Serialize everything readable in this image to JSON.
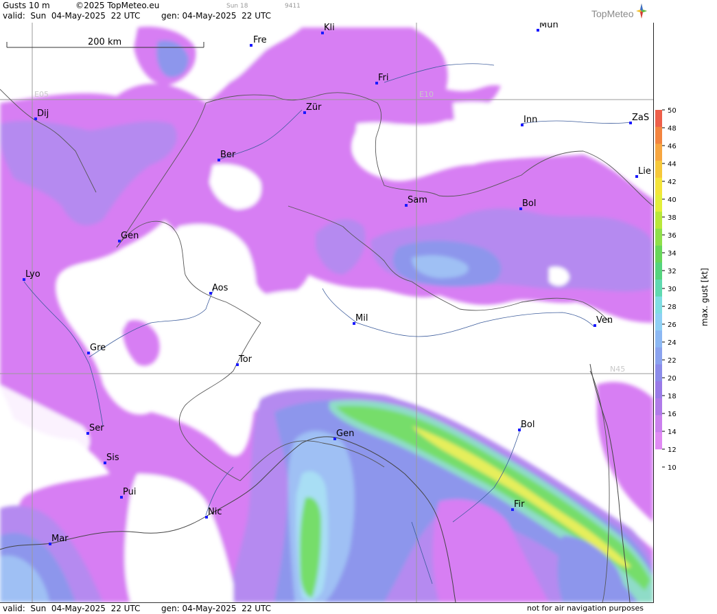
{
  "header": {
    "product": "Gusts 10 m",
    "copyright": "©2025 TopMeteo.eu",
    "small1": "Sun 18",
    "small2": "9411",
    "valid": "valid:  Sun  04-May-2025  22 UTC",
    "gen": "gen: 04-May-2025  22 UTC",
    "logo": "TopMeteo"
  },
  "footer": {
    "valid": "valid:  Sun  04-May-2025  22 UTC",
    "gen": "gen: 04-May-2025  22 UTC",
    "note": "not for air navigation purposes"
  },
  "scale": {
    "label": "200 km"
  },
  "grid_labels": {
    "e05": "E05",
    "e10": "E10",
    "n45": "N45"
  },
  "cities": [
    {
      "name": "Kli"
    },
    {
      "name": "Mün"
    },
    {
      "name": "Fre"
    },
    {
      "name": "Fri"
    },
    {
      "name": "Dij"
    },
    {
      "name": "Zür"
    },
    {
      "name": "Inn"
    },
    {
      "name": "ZaS"
    },
    {
      "name": "Ber"
    },
    {
      "name": "Lie"
    },
    {
      "name": "Sam"
    },
    {
      "name": "Bol"
    },
    {
      "name": "Gen"
    },
    {
      "name": "Lyo"
    },
    {
      "name": "Aos"
    },
    {
      "name": "Mil"
    },
    {
      "name": "Ven"
    },
    {
      "name": "Gre"
    },
    {
      "name": "Tor"
    },
    {
      "name": "Ser"
    },
    {
      "name": "Gen"
    },
    {
      "name": "Bol"
    },
    {
      "name": "Sis"
    },
    {
      "name": "Pui"
    },
    {
      "name": "Nic"
    },
    {
      "name": "Fir"
    },
    {
      "name": "Mar"
    }
  ],
  "legend": {
    "title": "max. gust [kt]",
    "ticks": [
      "50",
      "48",
      "46",
      "44",
      "42",
      "40",
      "38",
      "36",
      "34",
      "32",
      "30",
      "28",
      "26",
      "24",
      "22",
      "20",
      "18",
      "16",
      "14",
      "12",
      "10"
    ],
    "colors": [
      "#ee5f4a",
      "#f3843f",
      "#f7a640",
      "#f6c83a",
      "#f4e43a",
      "#e3ef3a",
      "#b9e83a",
      "#8fdf4a",
      "#67d65a",
      "#55d47e",
      "#5fd9b0",
      "#7fdde3",
      "#8fd0f5",
      "#8cb8f3",
      "#8ba3ef",
      "#8c8cea",
      "#9a7ae8",
      "#b07ae9",
      "#cb80ee",
      "#e08af3"
    ],
    "palette": {
      "violet": "#d77ef3",
      "lilac": "#b58af0",
      "blue": "#8d96ec",
      "lightblue": "#9fc0f4",
      "cyan": "#a8def4",
      "teal": "#8fdcc8",
      "green": "#76dd6a",
      "yellow": "#e6ee5c"
    }
  }
}
